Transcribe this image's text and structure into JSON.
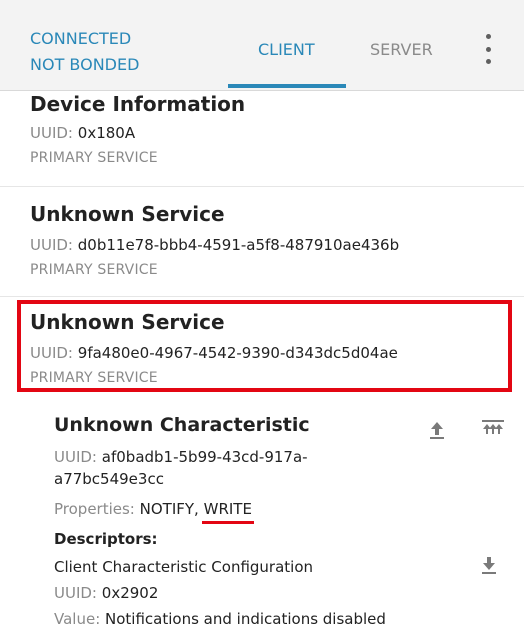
{
  "header": {
    "status_line1": "CONNECTED",
    "status_line2": "NOT BONDED",
    "tabs": [
      {
        "label": "CLIENT",
        "active": true
      },
      {
        "label": "SERVER",
        "active": false
      }
    ],
    "menu_icon": "more-vert-icon"
  },
  "services": [
    {
      "title": "Device Information",
      "uuid_label": "UUID:",
      "uuid": "0x180A",
      "type": "PRIMARY SERVICE"
    },
    {
      "title": "Unknown Service",
      "uuid_label": "UUID:",
      "uuid": "d0b11e78-bbb4-4591-a5f8-487910ae436b",
      "type": "PRIMARY SERVICE"
    },
    {
      "title": "Unknown Service",
      "uuid_label": "UUID:",
      "uuid": "9fa480e0-4967-4542-9390-d343dc5d04ae",
      "type": "PRIMARY SERVICE"
    }
  ],
  "characteristic": {
    "title": "Unknown Characteristic",
    "uuid_label": "UUID:",
    "uuid": "af0badb1-5b99-43cd-917a-a77bc549e3cc",
    "properties_label": "Properties:",
    "properties_notify": "NOTIFY,",
    "properties_write": "WRITE",
    "descriptors_label": "Descriptors:",
    "descriptor": {
      "name": "Client Characteristic Configuration",
      "uuid_label": "UUID:",
      "uuid": "0x2902",
      "value_label": "Value:",
      "value": "Notifications and indications disabled"
    },
    "icons": [
      "upload-icon",
      "notify-toggle-icon",
      "download-icon"
    ]
  },
  "colors": {
    "accent": "#2a88b8",
    "highlight": "#e30613"
  }
}
